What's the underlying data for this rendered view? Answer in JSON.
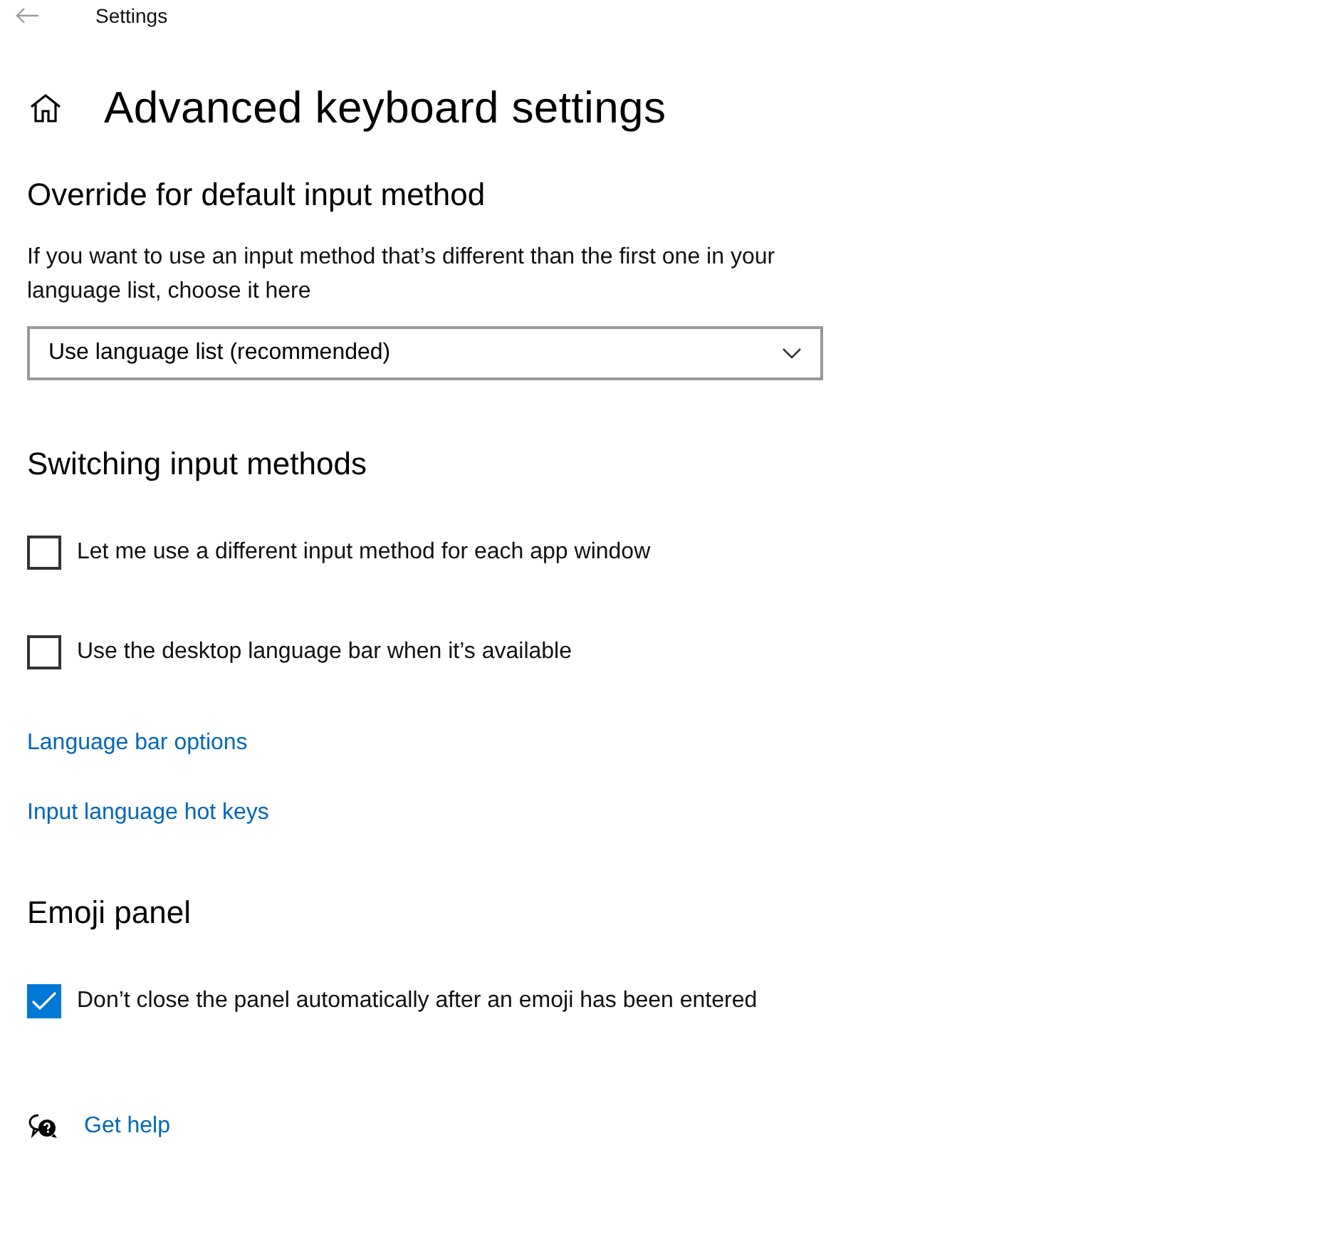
{
  "window": {
    "title": "Settings"
  },
  "page_title": "Advanced keyboard settings",
  "sections": [
    {
      "heading": "Override for default input method",
      "items": [
        {
          "kind": "paragraph",
          "text": "If you want to use an input method that’s different than the first one in your language list, choose it here"
        },
        {
          "kind": "dropdown",
          "value": "Use language list (recommended)"
        }
      ]
    },
    {
      "heading": "Switching input methods",
      "items": [
        {
          "kind": "checkbox",
          "label": "Let me use a different input method for each app window",
          "checked": false
        },
        {
          "kind": "checkbox",
          "label": "Use the desktop language bar when it’s available",
          "checked": false
        },
        {
          "kind": "link",
          "label": "Language bar options"
        },
        {
          "kind": "link",
          "label": "Input language hot keys"
        }
      ]
    },
    {
      "heading": "Emoji panel",
      "items": [
        {
          "kind": "checkbox",
          "label": "Don’t close the panel automatically after an emoji has been entered",
          "checked": true
        }
      ]
    }
  ],
  "help_link": "Get help"
}
